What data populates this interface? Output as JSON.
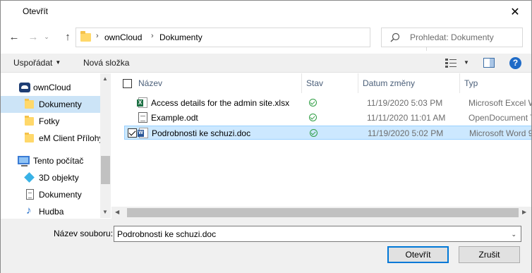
{
  "window": {
    "title": "Otevřít",
    "close_glyph": "✕"
  },
  "nav": {
    "back_icon": "arrow-left-icon",
    "forward_icon": "arrow-right-icon",
    "up_icon": "arrow-up-icon",
    "breadcrumbs": [
      "ownCloud",
      "Dokumenty"
    ],
    "search_placeholder": "Prohledat: Dokumenty"
  },
  "toolbar": {
    "organize_label": "Uspořádat",
    "new_folder_label": "Nová složka"
  },
  "sidebar": {
    "items": [
      {
        "label": "ownCloud",
        "icon": "cloud-icon",
        "selected": false
      },
      {
        "label": "Dokumenty",
        "icon": "folder-icon",
        "selected": true
      },
      {
        "label": "Fotky",
        "icon": "folder-icon",
        "selected": false
      },
      {
        "label": "eM Client Přílohy",
        "icon": "folder-icon",
        "selected": false
      },
      {
        "label": "Tento počítač",
        "icon": "computer-icon",
        "selected": false
      },
      {
        "label": "3D objekty",
        "icon": "cube-icon",
        "selected": false
      },
      {
        "label": "Dokumenty",
        "icon": "document-icon",
        "selected": false
      },
      {
        "label": "Hudba",
        "icon": "music-icon",
        "selected": false
      }
    ]
  },
  "columns": {
    "name": "Název",
    "status": "Stav",
    "date": "Datum změny",
    "type": "Typ"
  },
  "files": [
    {
      "name": "Access details for the admin site.xlsx",
      "date": "11/19/2020 5:03 PM",
      "type": "Microsoft Excel W",
      "icon": "excel-file-icon",
      "status": "synced",
      "checked": false,
      "selected": false
    },
    {
      "name": "Example.odt",
      "date": "11/11/2020 11:01 AM",
      "type": "OpenDocument T",
      "icon": "odt-file-icon",
      "status": "synced",
      "checked": false,
      "selected": false
    },
    {
      "name": "Podrobnosti ke schuzi.doc",
      "date": "11/19/2020 5:02 PM",
      "type": "Microsoft Word 9",
      "icon": "word-file-icon",
      "status": "synced",
      "checked": true,
      "selected": true
    }
  ],
  "bottom": {
    "filename_label": "Název souboru:",
    "filename_value": "Podrobnosti ke schuzi.doc",
    "open_label": "Otevřít",
    "cancel_label": "Zrušit"
  },
  "colors": {
    "selection": "#cce8ff",
    "sidebar_selection": "#cce4f7",
    "accent": "#0078d7",
    "status_ok": "#2f9e44"
  }
}
